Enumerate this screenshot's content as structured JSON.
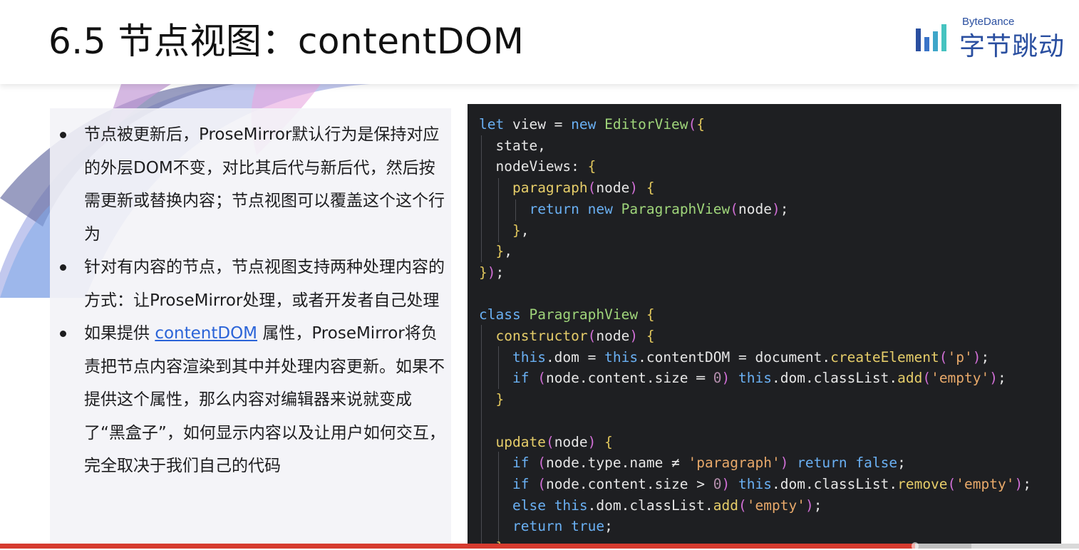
{
  "slide": {
    "title": "6.5 节点视图：contentDOM",
    "logo": {
      "top_text": "ByteDance",
      "main_text": "字节跳动",
      "color": "#2a4fa0"
    },
    "bullets": [
      {
        "text": "节点被更新后，ProseMirror默认行为是保持对应的外层DOM不变，对比其后代与新后代，然后按需更新或替换内容；节点视图可以覆盖这个这个行为"
      },
      {
        "text": "针对有内容的节点，节点视图支持两种处理内容的方式：让ProseMirror处理，或者开发者自己处理"
      },
      {
        "before": "如果提供 ",
        "link": "contentDOM",
        "after": " 属性，ProseMirror将负责把节点内容渲染到其中并处理内容更新。如果不提供这个属性，那么内容对编辑器来说就变成了“黑盒子”，如何显示内容以及让用户如何交互，完全取决于我们自己的代码"
      }
    ]
  },
  "code": {
    "lines": [
      "let view = new EditorView({",
      "  state,",
      "  nodeViews: {",
      "    paragraph(node) {",
      "      return new ParagraphView(node);",
      "    },",
      "  },",
      "});",
      "",
      "class ParagraphView {",
      "  constructor(node) {",
      "    this.dom = this.contentDOM = document.createElement('p');",
      "    if (node.content.size ═ 0) this.dom.classList.add('empty');",
      "  }",
      "",
      "  update(node) {",
      "    if (node.type.name ≠ 'paragraph') return false;",
      "    if (node.content.size > 0) this.dom.classList.remove('empty');",
      "    else this.dom.classList.add('empty');",
      "    return true;",
      "  }"
    ]
  },
  "player": {
    "progress": 0.848,
    "buffered": 0.9,
    "accent_color": "#d63b2f"
  }
}
